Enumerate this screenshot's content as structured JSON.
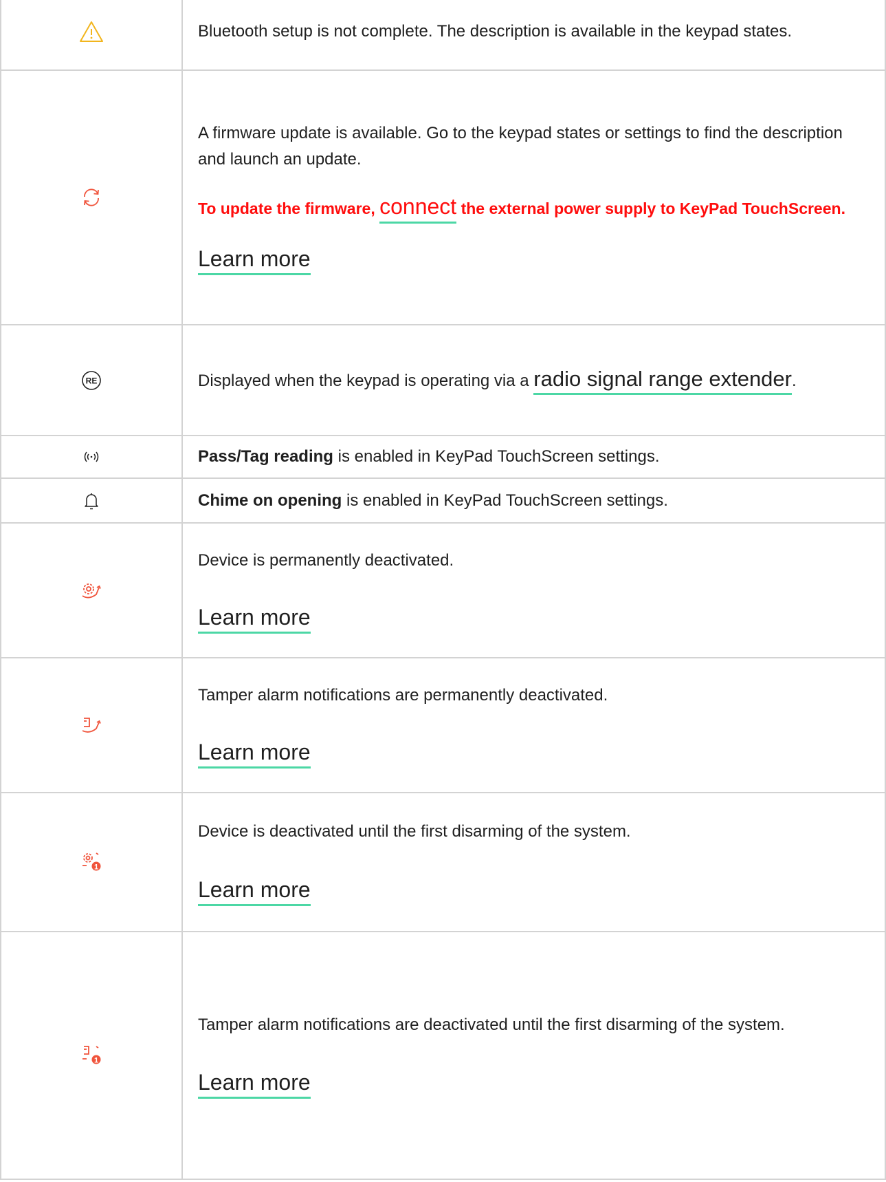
{
  "rows": [
    {
      "icon": "warning-triangle-icon",
      "text": "Bluetooth setup is not complete. The description is available in the keypad states."
    },
    {
      "icon": "firmware-update-icon",
      "text": "A firmware update is available. Go to the keypad states or settings to find the description and launch an update.",
      "warning_before": "To update the firmware, ",
      "warning_link": "connect",
      "warning_after": " the external power supply to KeyPad TouchScreen.",
      "link": "Learn more"
    },
    {
      "icon": "range-extender-icon",
      "text_before": "Displayed when the keypad is operating via a ",
      "link": "radio signal range extender",
      "text_after": "."
    },
    {
      "icon": "pass-tag-reading-icon",
      "bold": "Pass/Tag reading",
      "text": " is enabled in KeyPad TouchScreen settings."
    },
    {
      "icon": "bell-icon",
      "bold": "Chime on opening",
      "text": " is enabled in KeyPad TouchScreen settings."
    },
    {
      "icon": "device-deactivated-icon",
      "text": "Device is permanently deactivated.",
      "link": "Learn more"
    },
    {
      "icon": "tamper-deactivated-icon",
      "text": "Tamper alarm notifications are permanently deactivated.",
      "link": "Learn more"
    },
    {
      "icon": "device-deactivated-until-disarm-icon",
      "text": "Device is deactivated until the first disarming of the system.",
      "link": "Learn more"
    },
    {
      "icon": "tamper-deactivated-until-disarm-icon",
      "text": "Tamper alarm notifications are deactivated until the first disarming of the system.",
      "link": "Learn more"
    }
  ],
  "colors": {
    "icon_red": "#f0543c",
    "icon_yellow": "#f2b51d",
    "warning_red": "#ff0d0d",
    "link_underline": "#4cd7a5",
    "border": "#d3d3d3"
  }
}
